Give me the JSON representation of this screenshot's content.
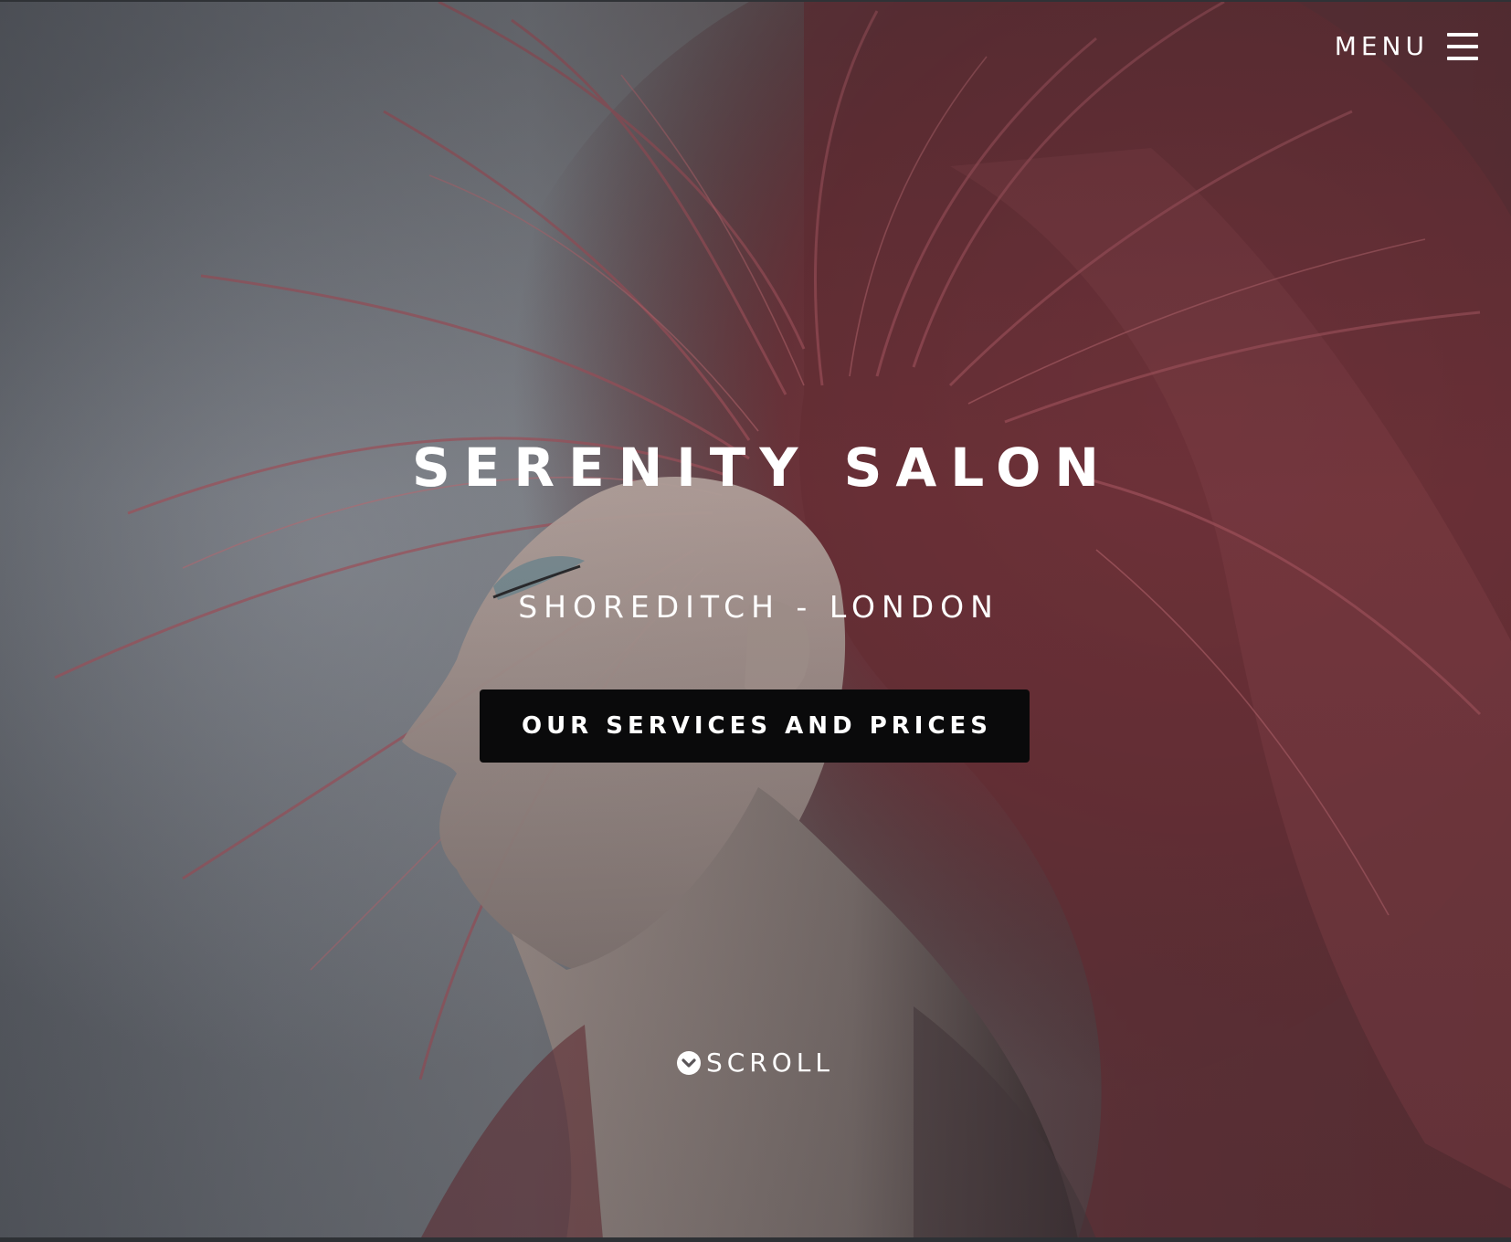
{
  "header": {
    "menu_label": "MENU",
    "menu_icon": "hamburger-icon"
  },
  "hero": {
    "title": "SERENITY SALON",
    "subtitle": "SHOREDITCH - LONDON",
    "cta_label": "OUR SERVICES AND PRICES",
    "scroll_label": "SCROLL",
    "scroll_icon": "chevron-down-circle-icon",
    "background_image": "woman-with-windswept-red-hair",
    "colors": {
      "text": "#ffffff",
      "cta_background": "#0a0a0b",
      "hair": "#9a4a52",
      "backdrop": "#6b6f76"
    }
  }
}
